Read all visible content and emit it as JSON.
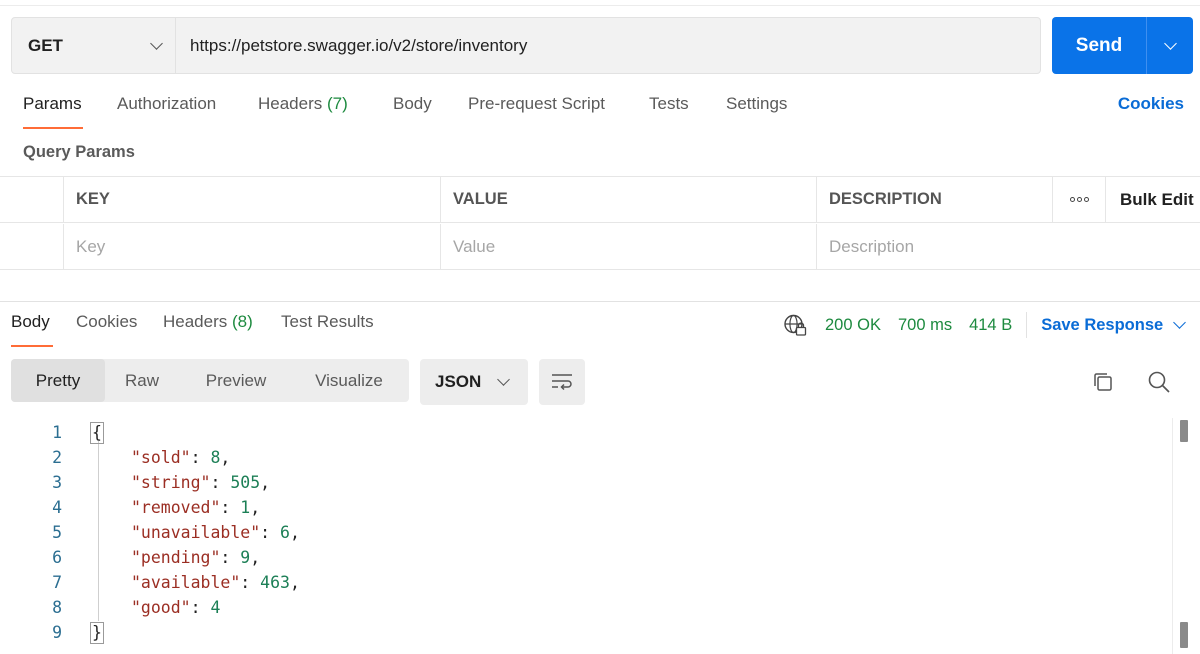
{
  "request": {
    "method": "GET",
    "url": "https://petstore.swagger.io/v2/store/inventory",
    "send_label": "Send"
  },
  "request_tabs": {
    "params": "Params",
    "authorization": "Authorization",
    "headers": "Headers",
    "headers_count": "(7)",
    "body": "Body",
    "pre_request": "Pre-request Script",
    "tests": "Tests",
    "settings": "Settings",
    "cookies": "Cookies"
  },
  "query_params": {
    "title": "Query Params",
    "columns": {
      "key": "KEY",
      "value": "VALUE",
      "description": "DESCRIPTION"
    },
    "bulk_edit": "Bulk Edit",
    "placeholders": {
      "key": "Key",
      "value": "Value",
      "description": "Description"
    }
  },
  "response_tabs": {
    "body": "Body",
    "cookies": "Cookies",
    "headers": "Headers",
    "headers_count": "(8)",
    "test_results": "Test Results"
  },
  "response_meta": {
    "status": "200 OK",
    "time": "700 ms",
    "size": "414 B",
    "save_label": "Save Response"
  },
  "view_modes": [
    "Pretty",
    "Raw",
    "Preview",
    "Visualize"
  ],
  "format": "JSON",
  "code": {
    "line_numbers": [
      "1",
      "2",
      "3",
      "4",
      "5",
      "6",
      "7",
      "8",
      "9"
    ],
    "open": "{",
    "close": "}",
    "entries": [
      {
        "key": "\"sold\"",
        "value": "8",
        "sep": ": ",
        "trail": ","
      },
      {
        "key": "\"string\"",
        "value": "505",
        "sep": ": ",
        "trail": ","
      },
      {
        "key": "\"removed\"",
        "value": "1",
        "sep": ": ",
        "trail": ","
      },
      {
        "key": "\"unavailable\"",
        "value": "6",
        "sep": ": ",
        "trail": ","
      },
      {
        "key": "\"pending\"",
        "value": "9",
        "sep": ": ",
        "trail": ","
      },
      {
        "key": "\"available\"",
        "value": "463",
        "sep": ": ",
        "trail": ","
      },
      {
        "key": "\"good\"",
        "value": "4",
        "sep": ": ",
        "trail": ""
      }
    ]
  },
  "colors": {
    "send": "#0a73e8",
    "accent_tab": "#ff6c37",
    "link": "#0a6cd6",
    "success": "#1d8a3f",
    "json_key": "#9b2e23",
    "json_number": "#1c7f56"
  },
  "icons": [
    "chevron-down-icon",
    "globe-lock-icon",
    "wrap-lines-icon",
    "copy-icon",
    "search-icon",
    "more-icon"
  ]
}
